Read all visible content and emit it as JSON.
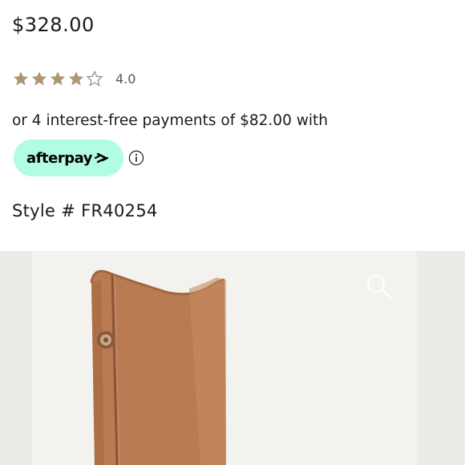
{
  "product": {
    "price": "$328.00",
    "rating": {
      "value": 4.0,
      "max": 5,
      "label": "4.0"
    },
    "installments_text": "or 4 interest-free payments of $82.00 with",
    "afterpay": {
      "brand_text": "afterpay",
      "badge_color": "#b2fce4"
    },
    "style_number": "Style # FR40254"
  },
  "colors": {
    "star": "#ad9674",
    "image_background": "#edebe6",
    "boot_leather": "#b97b51"
  },
  "icons": {
    "rating_star": "star-icon",
    "info": "info-icon",
    "zoom": "magnifier-icon"
  }
}
